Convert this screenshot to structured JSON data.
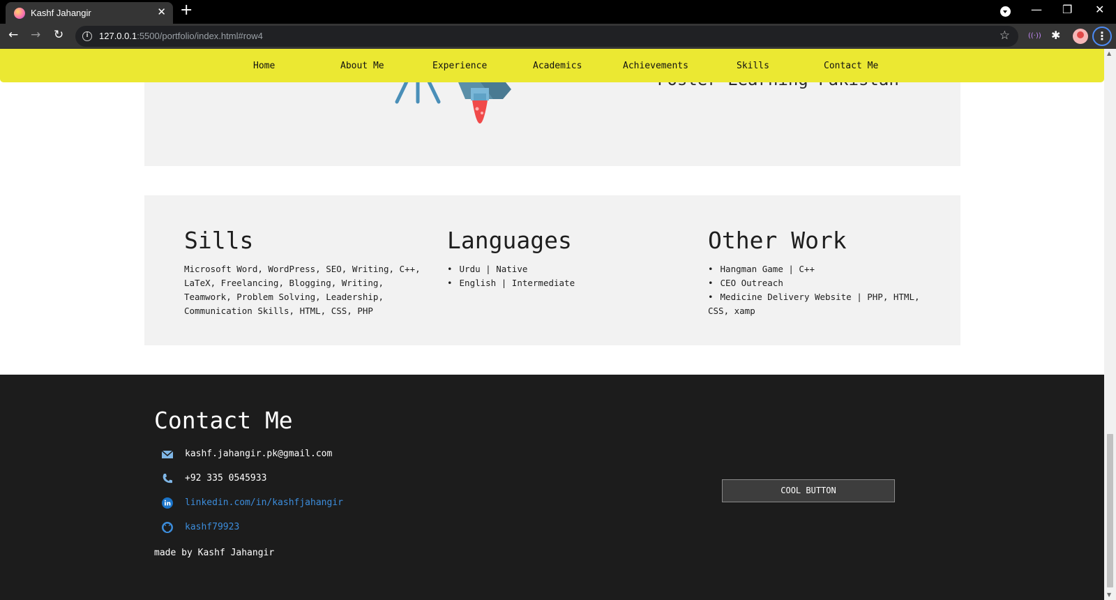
{
  "browser": {
    "tab": {
      "title": "Kashf Jahangir",
      "close": "✕",
      "new_tab": "+"
    },
    "window_controls": {
      "minimize": "—",
      "restore": "❐",
      "close": "✕"
    },
    "nav": {
      "back": "←",
      "forward": "→",
      "reload": "↻"
    },
    "address": {
      "host": "127.0.0.1",
      "rest": ":5500/portfolio/index.html#row4"
    },
    "icons": {
      "info": "i",
      "star": "☆",
      "menu": "⋮",
      "extension_media": "((·))",
      "extensions": "✱"
    }
  },
  "site_nav": {
    "items": [
      {
        "label": "Home"
      },
      {
        "label": "About Me"
      },
      {
        "label": "Experience"
      },
      {
        "label": "Academics"
      },
      {
        "label": "Achievements"
      },
      {
        "label": "Skills"
      },
      {
        "label": "Contact Me"
      }
    ],
    "background": "#ebe832"
  },
  "previous_section": {
    "partial_text": "Foster Learning Pakistan"
  },
  "skills_section": {
    "skills": {
      "title": "Sills",
      "text": "Microsoft Word, WordPress, SEO, Writing, C++, LaTeX, Freelancing, Blogging, Writing, Teamwork, Problem Solving, Leadership, Communication Skills, HTML, CSS, PHP"
    },
    "languages": {
      "title": "Languages",
      "items": [
        "Urdu | Native",
        "English | Intermediate"
      ]
    },
    "other_work": {
      "title": "Other Work",
      "items": [
        "Hangman Game | C++",
        "CEO Outreach",
        "Medicine Delivery Website | PHP, HTML, CSS, xamp"
      ]
    }
  },
  "footer": {
    "title": "Contact Me",
    "email": "kashf.jahangir.pk@gmail.com",
    "phone": "+92 335 0545933",
    "linkedin": "linkedin.com/in/kashfjahangir",
    "github": "kashf79923",
    "made_by": "made by Kashf Jahangir",
    "button": "COOL BUTTON",
    "background": "#1c1c1c",
    "link_color": "#3c8ddc"
  }
}
